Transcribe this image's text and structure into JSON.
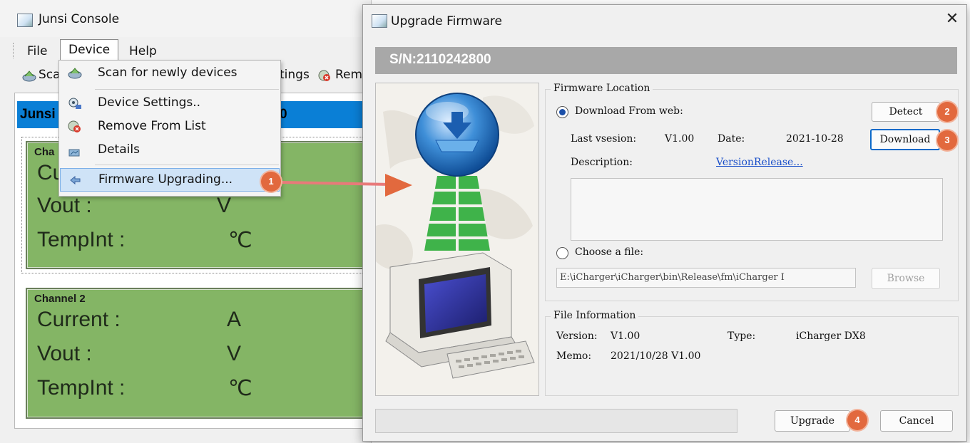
{
  "console": {
    "title": "Junsi Console",
    "menu": [
      "File",
      "Device",
      "Help"
    ],
    "toolbar": {
      "scan_partial": "Sca",
      "settings_partial": "tings",
      "remove_partial": "Rem"
    },
    "device_header_partial": "Junsi",
    "device_header_digit": "0",
    "channel1": {
      "title_partial": "Cha",
      "current_partial": "Cu",
      "vout_label": "Vout :",
      "vout_unit": "V",
      "tempint_label": "TempInt  :",
      "tempint_unit": "℃"
    },
    "channel2": {
      "title": "Channel 2",
      "current_label": "Current  :",
      "current_unit": "A",
      "vout_label": "Vout  :",
      "vout_unit": "V",
      "tempint_label": "TempInt  :",
      "tempint_unit": "℃"
    }
  },
  "device_menu": {
    "items": [
      {
        "label": "Scan for newly devices",
        "icon": "scan-icon"
      },
      {
        "label": "Device Settings..",
        "icon": "settings-icon"
      },
      {
        "label": "Remove From List",
        "icon": "remove-icon"
      },
      {
        "label": "Details",
        "icon": "details-icon"
      },
      {
        "label": "Firmware Upgrading...",
        "icon": "firmware-icon",
        "highlighted": true
      }
    ]
  },
  "badges": [
    "1",
    "2",
    "3",
    "4"
  ],
  "dialog": {
    "title": "Upgrade Firmware",
    "close": "✕",
    "serial": "S/N:2110242800",
    "firmware_location": {
      "group_title": "Firmware Location",
      "download_option": "Download From web:",
      "detect_button": "Detect",
      "download_button": "Download",
      "last_version_label": "Last vsesion:",
      "last_version_value": "V1.00",
      "date_label": "Date:",
      "date_value": "2021-10-28",
      "description_label": "Description:",
      "description_link": "VersionRelease...",
      "choose_file_option": "Choose a file:",
      "file_path": "E:\\iCharger\\iCharger\\bin\\Release\\fm\\iCharger I",
      "browse_button": "Browse"
    },
    "file_information": {
      "group_title": "File Information",
      "version_label": "Version:",
      "version_value": "V1.00",
      "type_label": "Type:",
      "type_value": "iCharger DX8",
      "memo_label": "Memo:",
      "memo_value": "2021/10/28 V1.00"
    },
    "upgrade_button": "Upgrade",
    "cancel_button": "Cancel"
  },
  "colors": {
    "accent": "#0a7fd6",
    "channel_bg": "#84b565",
    "badge": "#e2693e",
    "arrow": "#e2693e",
    "link": "#1a4fc9"
  }
}
